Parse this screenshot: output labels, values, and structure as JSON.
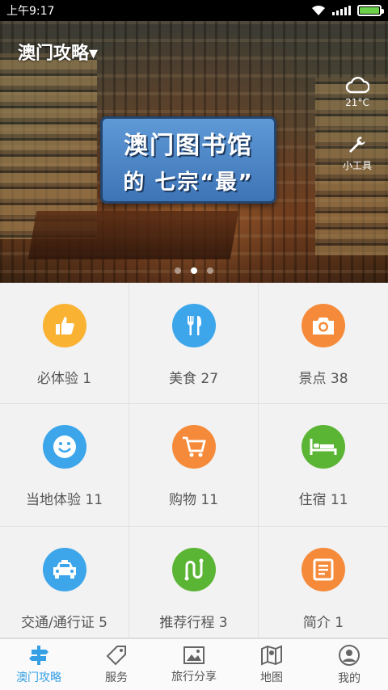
{
  "status_bar": {
    "time": "上午9:17"
  },
  "banner": {
    "city_label": "澳门攻略▾",
    "weather": {
      "icon": "cloud-icon",
      "temperature": "21°C"
    },
    "tools_label": "小工具",
    "poster_line1": "澳门图书馆",
    "poster_line2": "的 七宗“最”",
    "pager": {
      "count": 3,
      "active": 2
    }
  },
  "grid": [
    {
      "label": "必体验 1",
      "icon": "thumbs-up-icon",
      "color": "#f9b232"
    },
    {
      "label": "美食 27",
      "icon": "fork-knife-icon",
      "color": "#3da6eb"
    },
    {
      "label": "景点 38",
      "icon": "camera-icon",
      "color": "#f58b3a"
    },
    {
      "label": "当地体验 11",
      "icon": "smiley-icon",
      "color": "#3da6eb"
    },
    {
      "label": "购物 11",
      "icon": "shopping-cart-icon",
      "color": "#f58b3a"
    },
    {
      "label": "住宿 11",
      "icon": "bed-icon",
      "color": "#5bb534"
    },
    {
      "label": "交通/通行证 5",
      "icon": "taxi-icon",
      "color": "#3da6eb"
    },
    {
      "label": "推荐行程 3",
      "icon": "route-icon",
      "color": "#5bb534"
    },
    {
      "label": "简介 1",
      "icon": "document-icon",
      "color": "#f58b3a"
    }
  ],
  "tabs": [
    {
      "label": "澳门攻略",
      "icon": "signpost-icon",
      "active": true
    },
    {
      "label": "服务",
      "icon": "tag-icon",
      "active": false
    },
    {
      "label": "旅行分享",
      "icon": "picture-icon",
      "active": false
    },
    {
      "label": "地图",
      "icon": "map-icon",
      "active": false
    },
    {
      "label": "我的",
      "icon": "person-icon",
      "active": false
    }
  ],
  "colors": {
    "accent": "#35a0e6"
  }
}
